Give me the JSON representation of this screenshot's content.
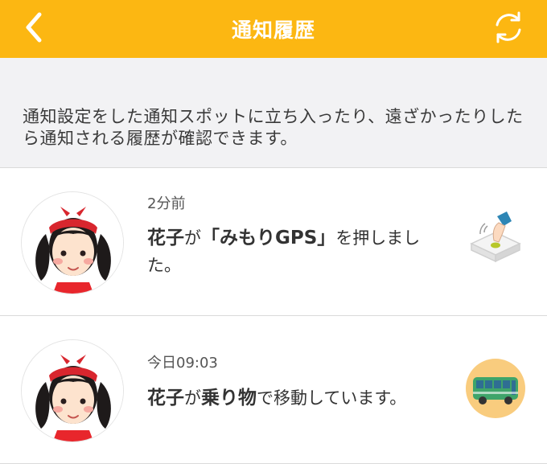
{
  "header": {
    "title": "通知履歴",
    "back_icon": "chevron-left-icon",
    "refresh_icon": "refresh-icon",
    "background_color": "#FCB712"
  },
  "intro": {
    "text": "通知設定をした通知スポットに立ち入ったり、遠ざかったりしたら通知される履歴が確認できます。"
  },
  "notifications": [
    {
      "time": "2分前",
      "name": "花子",
      "particle": "が",
      "action_bold": "「みもりGPS」",
      "action_rest": "を押しました。",
      "icon": "button-press-icon"
    },
    {
      "time": "今日09:03",
      "name": "花子",
      "particle": "が",
      "action_bold": "乗り物",
      "action_rest": "で移動しています。",
      "icon": "bus-icon"
    }
  ]
}
